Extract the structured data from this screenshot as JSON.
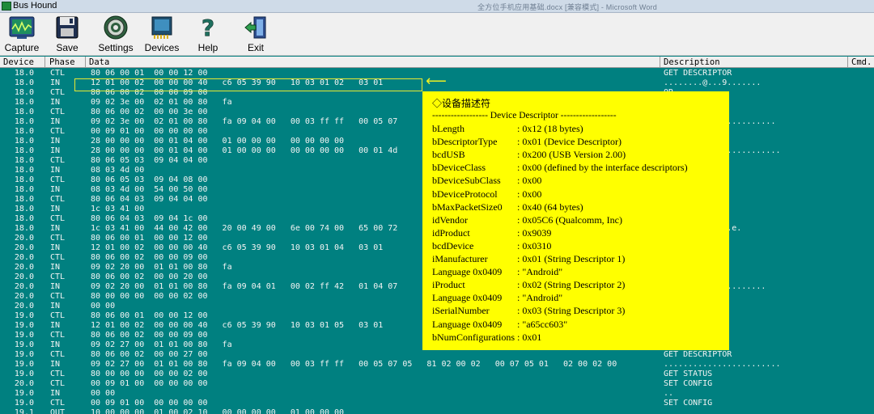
{
  "window": {
    "app_title": "Bus Hound",
    "background_doc_title": "全方位手机应用基础.docx  [兼容模式] - Microsoft Word"
  },
  "toolbar": {
    "buttons": [
      {
        "id": "capture",
        "label": "Capture",
        "icon": "capture-icon"
      },
      {
        "id": "save",
        "label": "Save",
        "icon": "save-icon"
      },
      {
        "id": "settings",
        "label": "Settings",
        "icon": "settings-icon"
      },
      {
        "id": "devices",
        "label": "Devices",
        "icon": "devices-icon"
      },
      {
        "id": "help",
        "label": "Help",
        "icon": "help-icon"
      },
      {
        "id": "exit",
        "label": "Exit",
        "icon": "exit-icon"
      }
    ]
  },
  "columns": {
    "device": "Device",
    "phase": "Phase",
    "data": "Data",
    "description": "Description",
    "cmd": "Cmd."
  },
  "rows": [
    {
      "device": "18.0",
      "phase": "CTL",
      "data": "80 06 00 01  00 00 12 00",
      "desc": "GET DESCRIPTOR"
    },
    {
      "device": "18.0",
      "phase": "IN",
      "data": "12 01 00 02  00 00 00 40   c6 05 39 90   10 03 01 02   03 01",
      "desc": "........@...9......."
    },
    {
      "device": "18.0",
      "phase": "CTL",
      "data": "80 06 00 02  00 00 09 00",
      "desc": "OR"
    },
    {
      "device": "18.0",
      "phase": "IN",
      "data": "09 02 3e 00  02 01 00 80   fa",
      "desc": ""
    },
    {
      "device": "18.0",
      "phase": "CTL",
      "data": "80 06 00 02  00 00 3e 00",
      "desc": "OR"
    },
    {
      "device": "18.0",
      "phase": "IN",
      "data": "09 02 3e 00  02 01 00 80   fa 09 04 00   00 03 ff ff   00 05 07",
      "desc": "......................."
    },
    {
      "device": "18.0",
      "phase": "CTL",
      "data": "00 09 01 00  00 00 00 00",
      "desc": ""
    },
    {
      "device": "18.0",
      "phase": "IN",
      "data": "28 00 00 00  00 01 04 00   01 00 00 00   00 00 00 00",
      "desc": "....."
    },
    {
      "device": "18.0",
      "phase": "IN",
      "data": "28 00 00 00  00 01 04 00   01 00 00 00   00 00 00 00   00 01 4d",
      "desc": "..........MTP..........."
    },
    {
      "device": "18.0",
      "phase": "CTL",
      "data": "80 06 05 03  09 04 04 00",
      "desc": "OR"
    },
    {
      "device": "18.0",
      "phase": "IN",
      "data": "08 03 4d 00",
      "desc": ""
    },
    {
      "device": "18.0",
      "phase": "CTL",
      "data": "80 06 05 03  09 04 08 00",
      "desc": "OR"
    },
    {
      "device": "18.0",
      "phase": "IN",
      "data": "08 03 4d 00  54 00 50 00",
      "desc": ""
    },
    {
      "device": "18.0",
      "phase": "CTL",
      "data": "80 06 04 03  09 04 04 00",
      "desc": "OR"
    },
    {
      "device": "18.0",
      "phase": "IN",
      "data": "1c 03 41 00",
      "desc": ""
    },
    {
      "device": "18.0",
      "phase": "CTL",
      "data": "80 06 04 03  09 04 1c 00",
      "desc": "OR"
    },
    {
      "device": "18.0",
      "phase": "IN",
      "data": "1c 03 41 00  44 00 42 00   20 00 49 00   6e 00 74 00   65 00 72",
      "desc": "n.t.e.r.f.a.c.e."
    },
    {
      "device": "20.0",
      "phase": "CTL",
      "data": "80 06 00 01  00 00 12 00",
      "desc": "OR"
    },
    {
      "device": "20.0",
      "phase": "IN",
      "data": "12 01 00 02  00 00 00 40   c6 05 39 90   10 03 01 04   03 01",
      "desc": "......."
    },
    {
      "device": "20.0",
      "phase": "CTL",
      "data": "80 06 00 02  00 00 09 00",
      "desc": "OR"
    },
    {
      "device": "20.0",
      "phase": "IN",
      "data": "09 02 20 00  01 01 00 80   fa",
      "desc": ""
    },
    {
      "device": "20.0",
      "phase": "CTL",
      "data": "80 06 00 02  00 00 20 00",
      "desc": "OR"
    },
    {
      "device": "20.0",
      "phase": "IN",
      "data": "09 02 20 00  01 01 00 80   fa 09 04 01   00 02 ff 42   01 04 07",
      "desc": "...B................."
    },
    {
      "device": "20.0",
      "phase": "CTL",
      "data": "80 00 00 00  00 00 02 00",
      "desc": ""
    },
    {
      "device": "20.0",
      "phase": "IN",
      "data": "00 00",
      "desc": ""
    },
    {
      "device": "19.0",
      "phase": "CTL",
      "data": "80 06 00 01  00 00 12 00",
      "desc": "OR"
    },
    {
      "device": "19.0",
      "phase": "IN",
      "data": "12 01 00 02  00 00 00 40   c6 05 39 90   10 03 01 05   03 01",
      "desc": "......."
    },
    {
      "device": "19.0",
      "phase": "CTL",
      "data": "80 06 00 02  00 00 09 00",
      "desc": "OR"
    },
    {
      "device": "19.0",
      "phase": "IN",
      "data": "09 02 27 00  01 01 00 80   fa",
      "desc": ""
    },
    {
      "device": "19.0",
      "phase": "CTL",
      "data": "80 06 00 02  00 00 27 00",
      "desc": "GET DESCRIPTOR"
    },
    {
      "device": "19.0",
      "phase": "IN",
      "data": "09 02 27 00  01 01 00 80   fa 09 04 00   00 03 ff ff   00 05 07 05   81 02 00 02   00 07 05 01   02 00 02 00",
      "desc": "........................"
    },
    {
      "device": "19.0",
      "phase": "CTL",
      "data": "80 00 00 00  00 00 02 00",
      "desc": "GET STATUS"
    },
    {
      "device": "20.0",
      "phase": "CTL",
      "data": "00 09 01 00  00 00 00 00",
      "desc": "SET CONFIG"
    },
    {
      "device": "19.0",
      "phase": "IN",
      "data": "00 00",
      "desc": ".."
    },
    {
      "device": "19.0",
      "phase": "CTL",
      "data": "00 09 01 00  00 00 00 00",
      "desc": "SET CONFIG"
    },
    {
      "device": "19.1",
      "phase": "OUT",
      "data": "10 00 00 00  01 00 02 10   00 00 00 00   01 00 00 00",
      "desc": ""
    }
  ],
  "popup": {
    "title": "◇设备描述符",
    "heading": "------------------ Device Descriptor ------------------",
    "fields": [
      {
        "name": "bLength",
        "value": ": 0x12 (18 bytes)"
      },
      {
        "name": "bDescriptorType",
        "value": ": 0x01 (Device Descriptor)"
      },
      {
        "name": "bcdUSB",
        "value": ": 0x200 (USB Version 2.00)"
      },
      {
        "name": "bDeviceClass",
        "value": ": 0x00 (defined by the interface descriptors)"
      },
      {
        "name": "bDeviceSubClass",
        "value": ": 0x00"
      },
      {
        "name": "bDeviceProtocol",
        "value": ": 0x00"
      },
      {
        "name": "bMaxPacketSize0",
        "value": ": 0x40 (64 bytes)"
      },
      {
        "name": "idVendor",
        "value": ": 0x05C6 (Qualcomm, Inc)"
      },
      {
        "name": "idProduct",
        "value": ": 0x9039"
      },
      {
        "name": "bcdDevice",
        "value": ": 0x0310"
      },
      {
        "name": "iManufacturer",
        "value": ": 0x01 (String Descriptor 1)"
      },
      {
        "name": " Language 0x0409",
        "value": ": \"Android\""
      },
      {
        "name": "iProduct",
        "value": ": 0x02 (String Descriptor 2)"
      },
      {
        "name": " Language 0x0409",
        "value": ": \"Android\""
      },
      {
        "name": "iSerialNumber",
        "value": ": 0x03 (String Descriptor 3)"
      },
      {
        "name": " Language 0x0409",
        "value": ": \"a65cc603\""
      },
      {
        "name": "bNumConfigurations",
        "value": ": 0x01"
      }
    ]
  },
  "highlight_arrow": "⟵"
}
